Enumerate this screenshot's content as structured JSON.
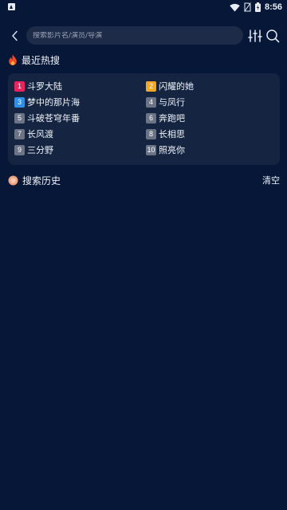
{
  "status_bar": {
    "time": "8:56",
    "icons": [
      "app-notification-icon",
      "wifi-icon",
      "no-sim-icon",
      "battery-charging-icon"
    ]
  },
  "search": {
    "placeholder": "搜索影片名/演员/导演",
    "back_icon": "chevron-left-icon",
    "filter_icon": "sliders-icon",
    "search_icon": "search-icon"
  },
  "hot": {
    "title": "最近热搜",
    "icon": "flame-icon",
    "items": [
      {
        "rank": "1",
        "name": "斗罗大陆",
        "color": "#e8245e"
      },
      {
        "rank": "2",
        "name": "闪耀的她",
        "color": "#f5a623"
      },
      {
        "rank": "3",
        "name": "梦中的那片海",
        "color": "#2f8fe6"
      },
      {
        "rank": "4",
        "name": "与凤行",
        "color": "#6b7385"
      },
      {
        "rank": "5",
        "name": "斗破苍穹年番",
        "color": "#6b7385"
      },
      {
        "rank": "6",
        "name": "奔跑吧",
        "color": "#6b7385"
      },
      {
        "rank": "7",
        "name": "长风渡",
        "color": "#6b7385"
      },
      {
        "rank": "8",
        "name": "长相思",
        "color": "#6b7385"
      },
      {
        "rank": "9",
        "name": "三分野",
        "color": "#6b7385"
      },
      {
        "rank": "10",
        "name": "照亮你",
        "color": "#6b7385"
      }
    ]
  },
  "history": {
    "title": "搜索历史",
    "icon": "history-dot-icon",
    "clear_label": "清空"
  },
  "colors": {
    "background": "#061737",
    "card": "#152541",
    "search_box": "#1d2b49",
    "accent_orange": "#f0a07a"
  }
}
